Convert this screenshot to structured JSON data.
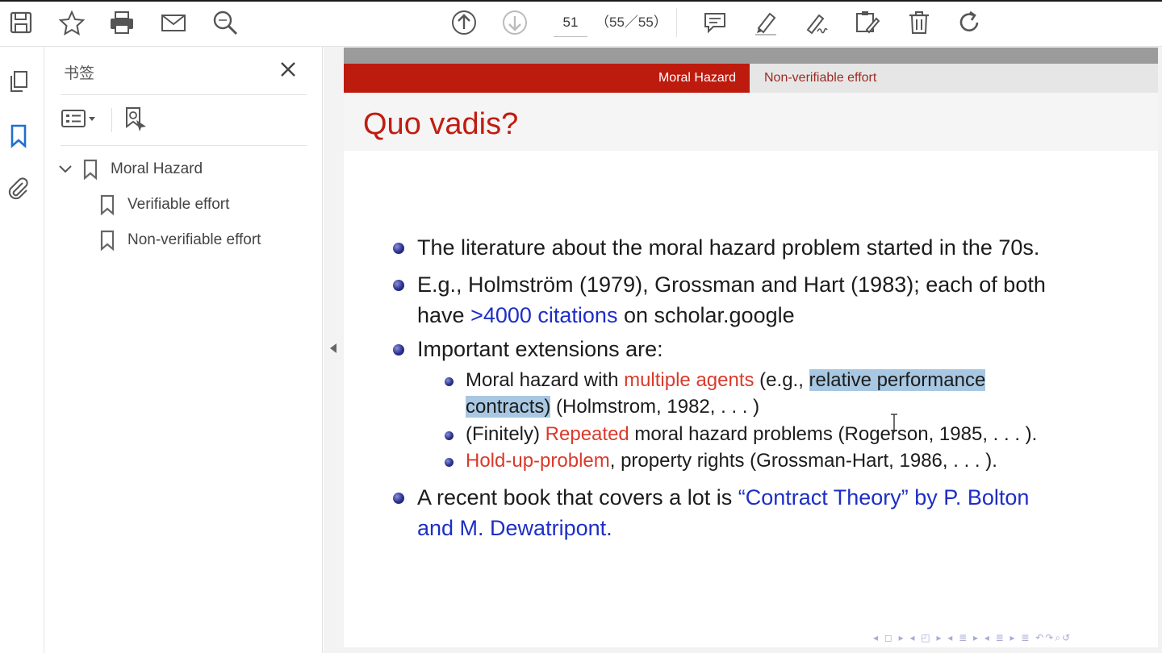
{
  "toolbar": {
    "icons": [
      "save-icon",
      "star-icon",
      "print-icon",
      "mail-icon",
      "search-icon",
      "page-up-icon",
      "page-down-icon",
      "comment-icon",
      "highlight-icon",
      "sign-icon",
      "edit-pdf-icon",
      "delete-icon",
      "rotate-icon"
    ],
    "page_number": "51",
    "page_total": "（55／55）"
  },
  "rail": {
    "icons": [
      "pages-icon",
      "bookmark-icon",
      "attachment-icon"
    ]
  },
  "panel": {
    "title": "书签",
    "bookmarks": [
      {
        "label": "Moral Hazard",
        "expanded": true,
        "level": 0
      },
      {
        "label": "Verifiable effort",
        "level": 1
      },
      {
        "label": "Non-verifiable effort",
        "level": 1
      }
    ]
  },
  "slide": {
    "nav_active": "Moral Hazard",
    "nav_inactive": "Non-verifiable effort",
    "title": "Quo vadis?",
    "b1": "The literature about the moral hazard problem started in the 70s.",
    "b2_line1": "E.g., Holmström (1979), Grossman and Hart (1983); each of both",
    "b2_have": "have ",
    "b2_link": ">4000 citations",
    "b2_rest": " on scholar.google",
    "b3": "Important extensions are:",
    "s1_a": "Moral hazard with ",
    "s1_red": "multiple agents",
    "s1_b": " (e.g., ",
    "s1_hl1": "relative performance",
    "s1_hl2": "contracts)",
    "s1_c": " (Holmstrom, 1982, . . . )",
    "s2_a": "(Finitely) ",
    "s2_red": "Repeated",
    "s2_b": " moral hazard problems (Rogerson, 1985, . . . ).",
    "s3_red": "Hold-up-problem",
    "s3_b": ", property rights (Grossman-Hart, 1986, . . . ).",
    "b4_a": "A recent book that covers a lot is ",
    "b4_link1": "“Contract Theory” by P. Bolton",
    "b4_link2": "and M. Dewatripont.",
    "beamer_nav": "◂ ◻ ▸ ◂ ◰ ▸ ◂ ≣ ▸ ◂ ≣ ▸  ≣  ↶↷⌕↺"
  },
  "colors": {
    "accent_red": "#be1b0f",
    "title_red": "#c01d12",
    "text_red": "#d93a2b",
    "link_blue": "#1d2ec5",
    "highlight": "#a8c7e2"
  }
}
